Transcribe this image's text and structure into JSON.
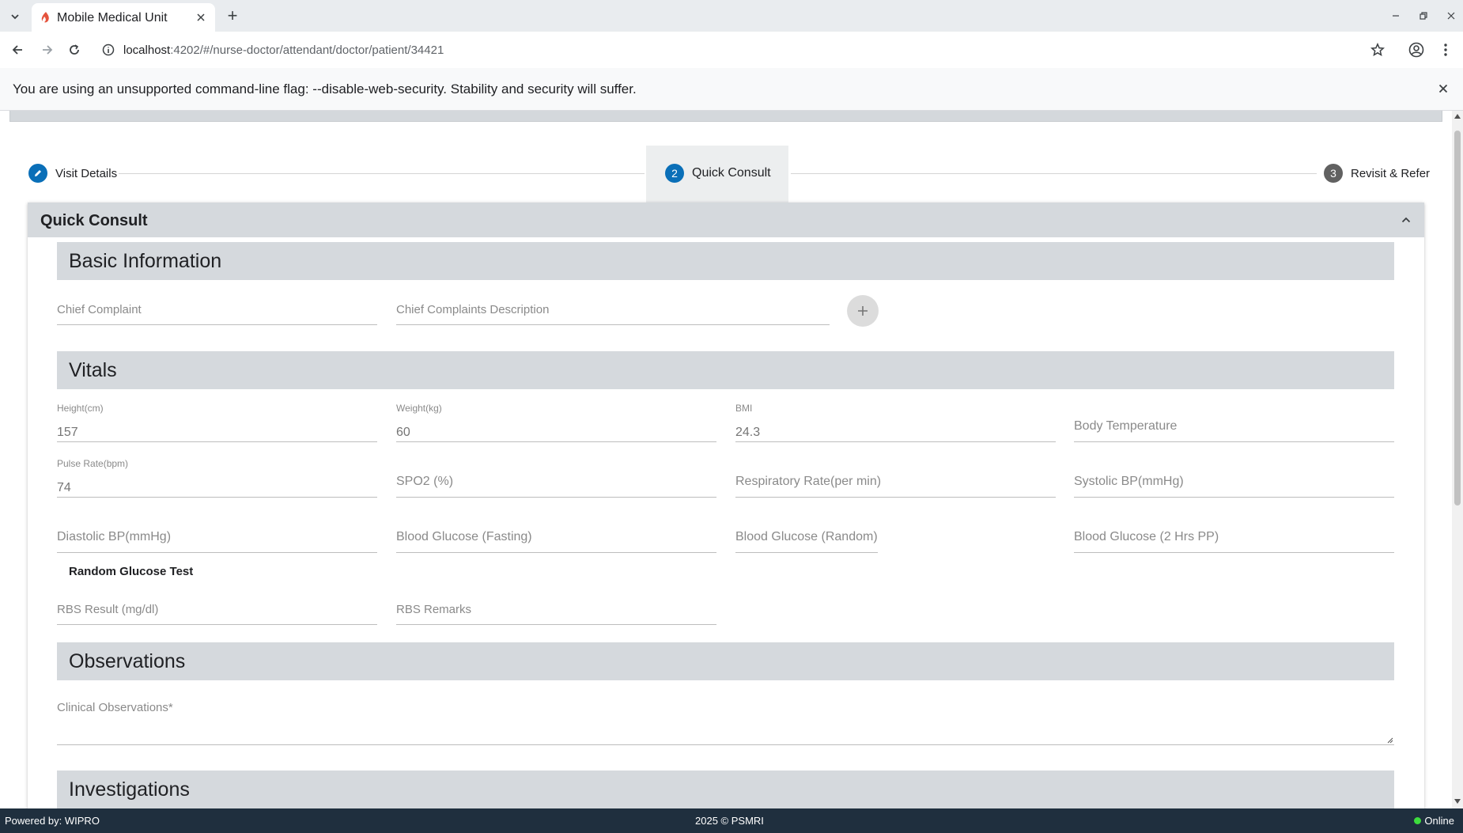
{
  "browser": {
    "tab_title": "Mobile Medical Unit",
    "new_tab_label": "+",
    "url_host": "localhost",
    "url_path": ":4202/#/nurse-doctor/attendant/doctor/patient/34421",
    "infobar_message": "You are using an unsupported command-line flag: --disable-web-security. Stability and security will suffer."
  },
  "stepper": {
    "steps": [
      {
        "number": "",
        "label": "Visit Details",
        "state": "done"
      },
      {
        "number": "2",
        "label": "Quick Consult",
        "state": "active"
      },
      {
        "number": "3",
        "label": "Revisit & Refer",
        "state": "pending"
      }
    ]
  },
  "card": {
    "title": "Quick Consult",
    "sections": {
      "basic": "Basic Information",
      "vitals": "Vitals",
      "observations": "Observations",
      "investigations": "Investigations"
    },
    "basic_fields": {
      "chief_complaint": "Chief Complaint",
      "chief_complaint_desc": "Chief Complaints Description",
      "add_label": "+"
    },
    "vitals": {
      "height_label": "Height(cm)",
      "height_value": "157",
      "weight_label": "Weight(kg)",
      "weight_value": "60",
      "bmi_label": "BMI",
      "bmi_value": "24.3",
      "body_temp": "Body Temperature",
      "pulse_label": "Pulse Rate(bpm)",
      "pulse_value": "74",
      "spo2": "SPO2 (%)",
      "resp_rate": "Respiratory Rate(per min)",
      "systolic": "Systolic BP(mmHg)",
      "diastolic": "Diastolic BP(mmHg)",
      "bg_fasting": "Blood Glucose (Fasting)",
      "bg_random": "Blood Glucose (Random)",
      "bg_2hrs": "Blood Glucose (2 Hrs PP)"
    },
    "rbs": {
      "heading": "Random Glucose Test",
      "result": "RBS Result (mg/dl)",
      "remarks": "RBS Remarks"
    },
    "observations": {
      "clinical": "Clinical Observations*"
    }
  },
  "footer": {
    "powered_by": "Powered by: WIPRO",
    "copyright": "2025 © PSMRI",
    "status": "Online"
  },
  "colors": {
    "accent": "#0a6fb8",
    "step_pending": "#616161",
    "section_bg": "#d5d9dd",
    "footer_bg": "#1f2f3e",
    "online": "#3ddc3d"
  }
}
